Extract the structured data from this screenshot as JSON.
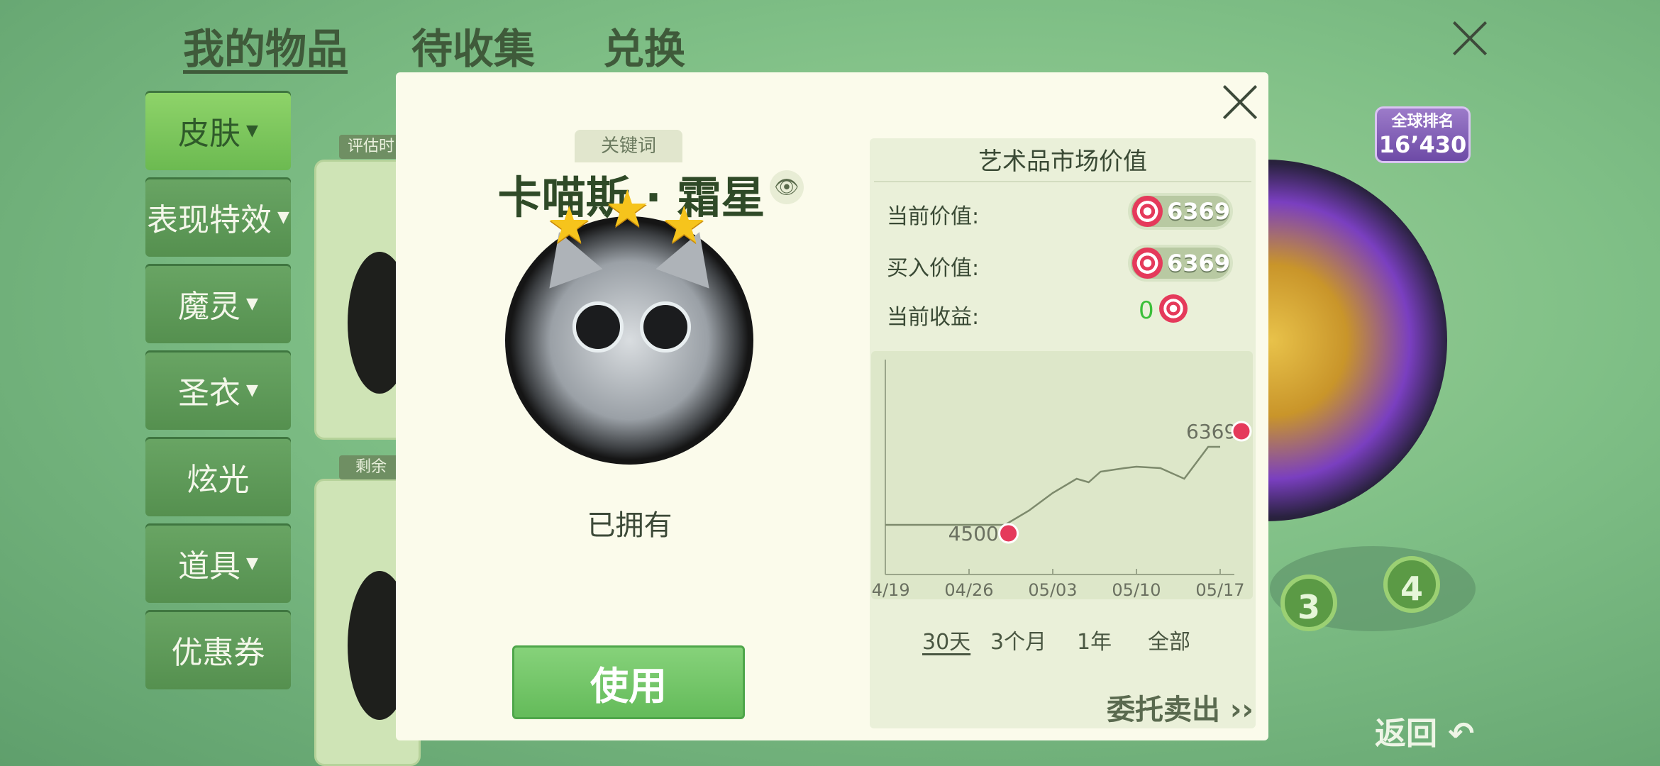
{
  "top_tabs": [
    "我的物品",
    "待收集",
    "兑换"
  ],
  "sidebar": [
    "皮肤",
    "表现特效",
    "魔灵",
    "圣衣",
    "炫光",
    "道具",
    "优惠券"
  ],
  "bg_labels": [
    "评估时",
    "剩余"
  ],
  "ranking": {
    "badge": "全球排名",
    "value": "16’430"
  },
  "modal": {
    "keyword": "关键词",
    "name": "卡喵斯 · 霜星",
    "stars": 3,
    "status": "已拥有",
    "use_label": "使用"
  },
  "market": {
    "title": "艺术品市场价值",
    "current_label": "当前价值:",
    "current_value": "6369",
    "buy_label": "买入价值:",
    "buy_value": "6369",
    "profit_label": "当前收益:",
    "profit_value": "0",
    "ranges": [
      "30天",
      "3个月",
      "1年",
      "全部"
    ],
    "sell_label": "委托卖出"
  },
  "chart_data": {
    "type": "line",
    "x_ticks": [
      "04/19",
      "04/26",
      "05/03",
      "05/10",
      "05/17"
    ],
    "points": [
      [
        "04/19",
        4500
      ],
      [
        "04/26",
        4500
      ],
      [
        "04/29",
        4500
      ],
      [
        "05/01",
        4700
      ],
      [
        "05/03",
        4950
      ],
      [
        "05/05",
        5150
      ],
      [
        "05/06",
        5100
      ],
      [
        "05/07",
        5250
      ],
      [
        "05/09",
        5300
      ],
      [
        "05/10",
        5320
      ],
      [
        "05/12",
        5300
      ],
      [
        "05/14",
        5150
      ],
      [
        "05/16",
        5600
      ],
      [
        "05/17",
        5600
      ]
    ],
    "annotations": [
      {
        "x": "04/29",
        "y": 4500,
        "label": "4500"
      },
      {
        "x": "05/17",
        "y": 5600,
        "label": "6369"
      }
    ]
  },
  "badges": [
    "3",
    "4"
  ],
  "back_label": "返回"
}
